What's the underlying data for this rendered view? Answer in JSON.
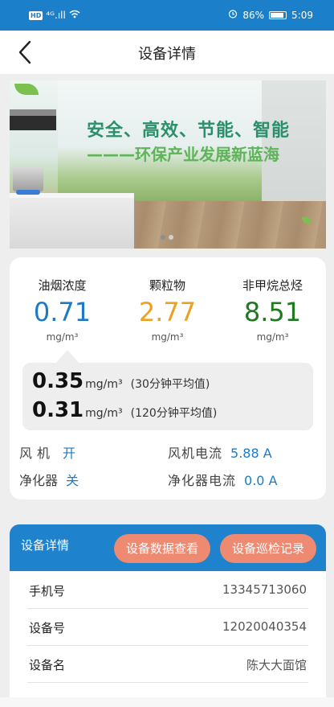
{
  "status_bar": {
    "network_badge": "HD",
    "signal_text": "⁴ᴳ.ıll",
    "wifi_icon": "wifi-icon",
    "alarm_icon": "alarm-icon",
    "battery_percent": "86%",
    "time": "5:09"
  },
  "header": {
    "title": "设备详情",
    "back_icon": "back-arrow-icon"
  },
  "banner": {
    "headline": "安全、高效、节能、智能",
    "subline": "———环保产业发展新蓝海",
    "slide_count": 2,
    "active_slide": 1
  },
  "metrics": [
    {
      "label": "油烟浓度",
      "value": "0.71",
      "unit": "mg/m³",
      "color": "#1d7ac7"
    },
    {
      "label": "颗粒物",
      "value": "2.77",
      "unit": "mg/m³",
      "color": "#f0a11c"
    },
    {
      "label": "非甲烷总烃",
      "value": "8.51",
      "unit": "mg/m³",
      "color": "#1f7a1f"
    }
  ],
  "averages": [
    {
      "value": "0.35",
      "unit": "mg/m³",
      "note": "(30分钟平均值)"
    },
    {
      "value": "0.31",
      "unit": "mg/m³",
      "note": "(120分钟平均值)"
    }
  ],
  "status": {
    "fan_label": "风机",
    "fan_value": "开",
    "fan_current_label": "风机电流",
    "fan_current_value": "5.88 A",
    "purifier_label": "净化器",
    "purifier_value": "关",
    "purifier_current_label": "净化器电流",
    "purifier_current_value": "0.0 A"
  },
  "details": {
    "title": "设备详情",
    "view_data_button": "设备数据查看",
    "inspection_button": "设备巡检记录",
    "rows": [
      {
        "label": "手机号",
        "value": "13345713060"
      },
      {
        "label": "设备号",
        "value": "12020040354"
      },
      {
        "label": "设备名",
        "value": "陈大大面馆"
      }
    ]
  },
  "colors": {
    "primary": "#1c7fc9",
    "accent_button": "#ee8a72"
  }
}
